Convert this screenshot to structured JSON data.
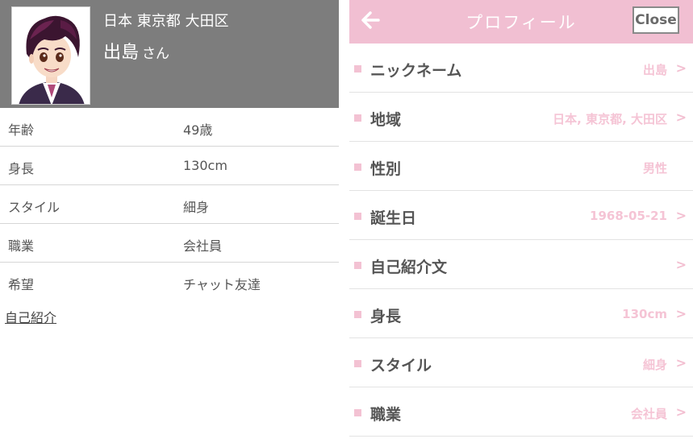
{
  "left_panel": {
    "header": {
      "location": "日本 東京都 大田区",
      "name": "出島",
      "name_suffix": "さん",
      "header_color": "#7d7d7d"
    },
    "info_rows": [
      {
        "label": "年齢",
        "value": "49歳"
      },
      {
        "label": "身長",
        "value": "130cm"
      },
      {
        "label": "スタイル",
        "value": "細身"
      },
      {
        "label": "職業",
        "value": "会社員"
      },
      {
        "label": "希望",
        "value": "チャット友達"
      }
    ],
    "intro_link": "自己紹介"
  },
  "right_panel": {
    "header": {
      "title": "プロフィール",
      "back_icon": "arrow-left-icon",
      "close_label": "Close",
      "header_color": "#f1bfd2"
    },
    "accent_color": "#f3c2d3",
    "rows": [
      {
        "label": "ニックネーム",
        "value": "出島",
        "chevron": ">"
      },
      {
        "label": "地域",
        "value": "日本, 東京都, 大田区",
        "chevron": ">"
      },
      {
        "label": "性別",
        "value": "男性",
        "chevron": ""
      },
      {
        "label": "誕生日",
        "value": "1968-05-21",
        "chevron": ">"
      },
      {
        "label": "自己紹介文",
        "value": "",
        "chevron": ">"
      },
      {
        "label": "身長",
        "value": "130cm",
        "chevron": ">"
      },
      {
        "label": "スタイル",
        "value": "細身",
        "chevron": ">"
      },
      {
        "label": "職業",
        "value": "会社員",
        "chevron": ">"
      }
    ]
  }
}
